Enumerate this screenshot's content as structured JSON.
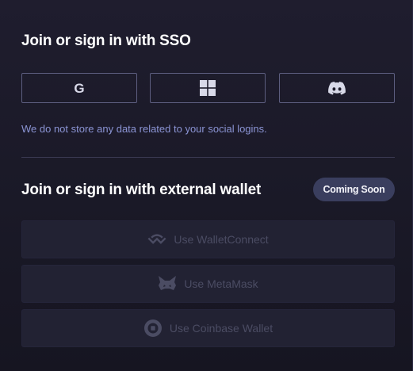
{
  "sso": {
    "title": "Join or sign in with SSO",
    "buttons": [
      {
        "provider": "Google",
        "icon": "google-icon",
        "glyph": "G"
      },
      {
        "provider": "Microsoft",
        "icon": "microsoft-icon"
      },
      {
        "provider": "Discord",
        "icon": "discord-icon"
      }
    ],
    "note": "We do not store any data related to your social logins."
  },
  "wallet": {
    "title": "Join or sign in with external wallet",
    "badge": "Coming Soon",
    "options": [
      {
        "label": "Use WalletConnect",
        "icon": "walletconnect-icon"
      },
      {
        "label": "Use MetaMask",
        "icon": "metamask-fox-icon"
      },
      {
        "label": "Use Coinbase Wallet",
        "icon": "coinbase-icon"
      }
    ]
  },
  "colors": {
    "background": "#1c1b2a",
    "border": "#5d5e80",
    "note_text": "#8b94d4",
    "badge_bg": "#3a3e5e",
    "disabled_text": "#4b4c63"
  }
}
